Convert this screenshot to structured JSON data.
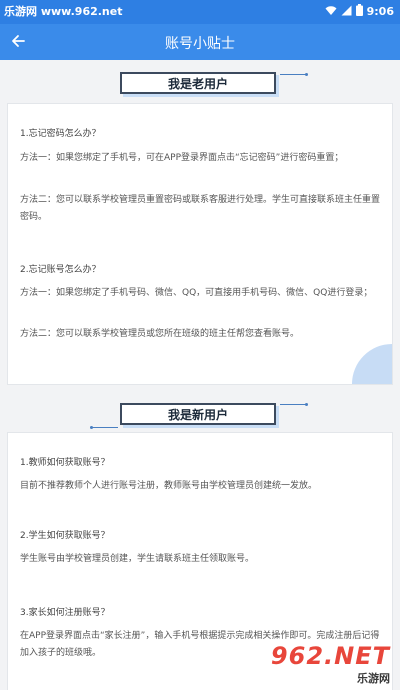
{
  "status_bar": {
    "site_label": "乐游网 www.962.net",
    "time": "9:06",
    "icons": [
      "wifi-icon",
      "signal-icon",
      "battery-icon"
    ]
  },
  "app_bar": {
    "title": "账号小贴士",
    "back_icon": "arrow-left-icon"
  },
  "old_user": {
    "heading": "我是老用户",
    "q1": "1.忘记密码怎么办？",
    "q1_method1": "方法一：如果您绑定了手机号，可在APP登录界面点击“忘记密码”进行密码重置；",
    "q1_method2": "方法二：您可以联系学校管理员重置密码或联系客服进行处理。学生可直接联系班主任重置密码。",
    "q2": "2.忘记账号怎么办？",
    "q2_method1": "方法一：如果您绑定了手机号码、微信、QQ，可直接用手机号码、微信、QQ进行登录；",
    "q2_method2": "方法二：您可以联系学校管理员或您所在班级的班主任帮您查看账号。"
  },
  "new_user": {
    "heading": "我是新用户",
    "q1": "1.教师如何获取账号？",
    "q1_answer": "目前不推荐教师个人进行账号注册，教师账号由学校管理员创建统一发放。",
    "q2": "2.学生如何获取账号？",
    "q2_answer": "学生账号由学校管理员创建，学生请联系班主任领取账号。",
    "q3": "3.家长如何注册账号？",
    "q3_answer": "在APP登录界面点击“家长注册”，输入手机号根据提示完成相关操作即可。完成注册后记得加入孩子的班级哦。"
  },
  "watermark": {
    "logo": "962.NET",
    "sub": "乐游网"
  },
  "colors": {
    "status_bar": "#2e7fe3",
    "app_bar": "#3a8bea",
    "background": "#f2f3f5",
    "card_accent": "#c7dcf5"
  }
}
